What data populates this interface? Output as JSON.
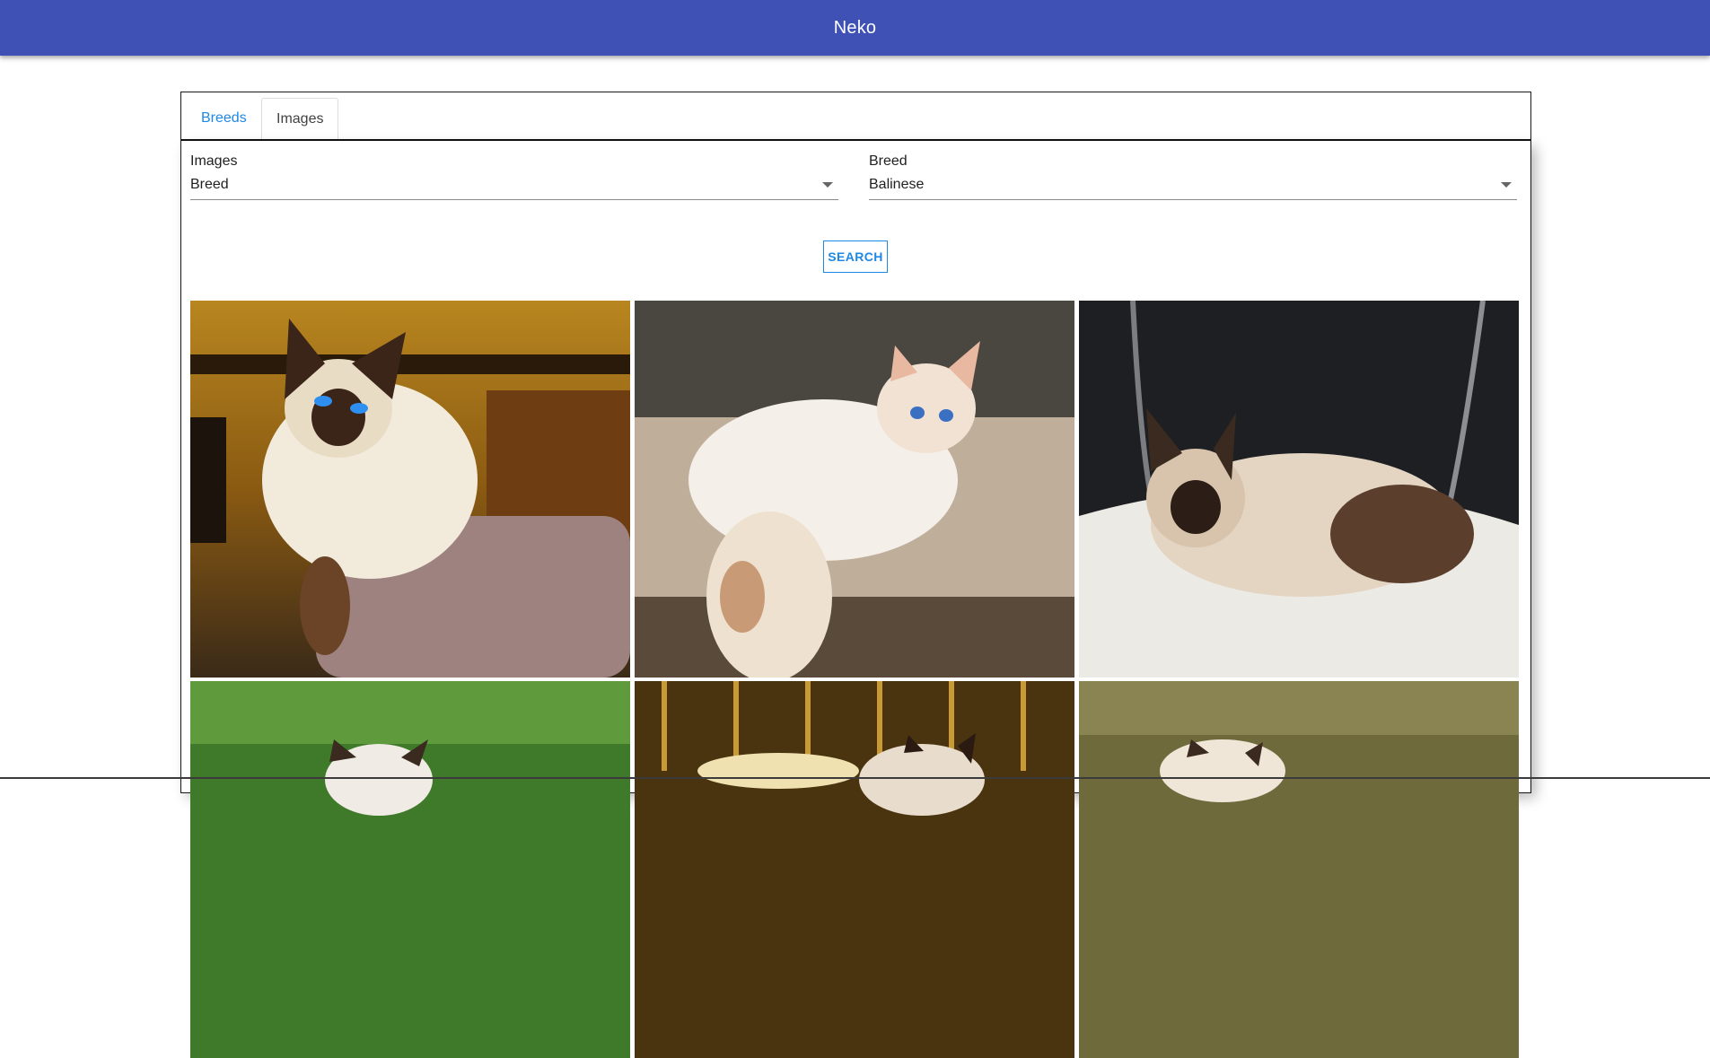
{
  "app": {
    "title": "Neko"
  },
  "tabs": [
    {
      "label": "Breeds",
      "active": false
    },
    {
      "label": "Images",
      "active": true
    }
  ],
  "filters": {
    "mode_label": "Images",
    "mode_value": "Breed",
    "breed_label": "Breed",
    "breed_value": "Balinese"
  },
  "search_button": {
    "label": "SEARCH"
  },
  "colors": {
    "appbar": "#3f51b5",
    "accent": "#1e88e5"
  },
  "images": [
    {
      "subject": "balinese-cat-on-scratching-post"
    },
    {
      "subject": "white-cat-on-cat-bed"
    },
    {
      "subject": "seal-point-cat-in-basket"
    },
    {
      "subject": "cat-on-grass"
    },
    {
      "subject": "cat-under-lamp"
    },
    {
      "subject": "cat-in-grass"
    }
  ]
}
